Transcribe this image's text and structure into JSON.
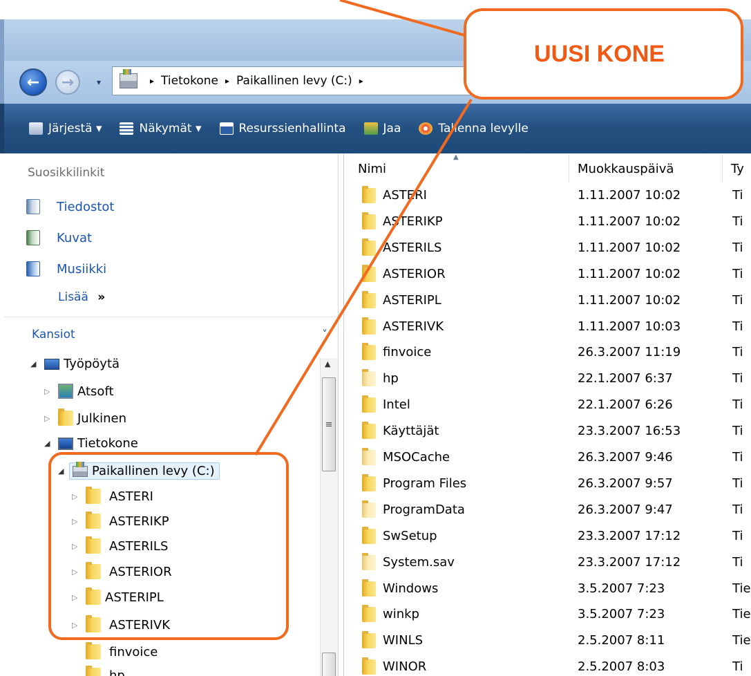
{
  "address": {
    "crumbs": [
      "Tietokone",
      "Paikallinen levy (C:)"
    ],
    "sep": "▸",
    "dropdown": "▾"
  },
  "nav": {
    "back_glyph": "←",
    "forward_glyph": "→"
  },
  "toolbar": {
    "items": [
      {
        "label": "Järjestä ▾",
        "icon": "organize-icon"
      },
      {
        "label": "Näkymät  ▾",
        "icon": "views-icon"
      },
      {
        "label": "Resurssienhallinta",
        "icon": "explorer-icon"
      },
      {
        "label": "Jaa",
        "icon": "share-icon"
      },
      {
        "label": "Tallenna levylle",
        "icon": "burn-icon"
      }
    ]
  },
  "favorites": {
    "title": "Suosikkilinkit",
    "links": [
      "Tiedostot",
      "Kuvat",
      "Musiikki"
    ],
    "more": "Lisää",
    "more_glyph": "»"
  },
  "folders": {
    "header": "Kansiot",
    "collapse_glyph": "˅",
    "tree": [
      {
        "label": "Työpöytä",
        "icon": "desktop-icon",
        "arrow": "◢"
      },
      {
        "label": "Atsoft",
        "icon": "atsoft-icon",
        "arrow": "▷"
      },
      {
        "label": "Julkinen",
        "icon": "folder-icon",
        "arrow": "▷"
      },
      {
        "label": "Tietokone",
        "icon": "computer-icon",
        "arrow": "◢"
      },
      {
        "label": "Paikallinen levy (C:)",
        "icon": "drive-icon",
        "arrow": "◢"
      },
      {
        "label": "ASTERI",
        "icon": "folder-icon",
        "arrow": "▷"
      },
      {
        "label": "ASTERIKP",
        "icon": "folder-icon",
        "arrow": "▷"
      },
      {
        "label": "ASTERILS",
        "icon": "folder-icon",
        "arrow": "▷"
      },
      {
        "label": "ASTERIOR",
        "icon": "folder-icon",
        "arrow": "▷"
      },
      {
        "label": "ASTERIPL",
        "icon": "folder-icon",
        "arrow": "▷"
      },
      {
        "label": "ASTERIVK",
        "icon": "folder-icon",
        "arrow": "▷"
      },
      {
        "label": "finvoice",
        "icon": "folder-icon",
        "arrow": ""
      },
      {
        "label": "hp",
        "icon": "folder-icon",
        "arrow": ""
      }
    ],
    "scroll_up": "▲",
    "scroll_grip": "≡"
  },
  "file_list": {
    "columns": [
      "Nimi",
      "Muokkauspäivä",
      "Ty"
    ],
    "sort_glyph": "▲",
    "rows": [
      {
        "name": "ASTERI",
        "date": "1.11.2007 10:02",
        "type": "Ti"
      },
      {
        "name": "ASTERIKP",
        "date": "1.11.2007 10:02",
        "type": "Ti"
      },
      {
        "name": "ASTERILS",
        "date": "1.11.2007 10:02",
        "type": "Ti"
      },
      {
        "name": "ASTERIOR",
        "date": "1.11.2007 10:02",
        "type": "Ti"
      },
      {
        "name": "ASTERIPL",
        "date": "1.11.2007 10:02",
        "type": "Ti"
      },
      {
        "name": "ASTERIVK",
        "date": "1.11.2007 10:03",
        "type": "Ti"
      },
      {
        "name": "finvoice",
        "date": "26.3.2007 11:19",
        "type": "Ti"
      },
      {
        "name": "hp",
        "date": "22.1.2007 6:37",
        "type": "Ti"
      },
      {
        "name": "Intel",
        "date": "22.1.2007 6:26",
        "type": "Ti"
      },
      {
        "name": "Käyttäjät",
        "date": "23.3.2007 16:53",
        "type": "Ti"
      },
      {
        "name": "MSOCache",
        "date": "26.3.2007 9:46",
        "type": "Ti"
      },
      {
        "name": "Program Files",
        "date": "26.3.2007 9:57",
        "type": "Ti"
      },
      {
        "name": "ProgramData",
        "date": "26.3.2007 9:47",
        "type": "Ti"
      },
      {
        "name": "SwSetup",
        "date": "23.3.2007 17:12",
        "type": "Ti"
      },
      {
        "name": "System.sav",
        "date": "23.3.2007 17:12",
        "type": "Ti"
      },
      {
        "name": "Windows",
        "date": "3.5.2007 7:23",
        "type": "Tie"
      },
      {
        "name": "winkp",
        "date": "3.5.2007 7:23",
        "type": "Tie"
      },
      {
        "name": "WINLS",
        "date": "2.5.2007 8:11",
        "type": "Tie"
      },
      {
        "name": "WINOR",
        "date": "2.5.2007 8:03",
        "type": "Ti"
      }
    ],
    "light_folders": [
      "hp",
      "MSOCache",
      "ProgramData",
      "System.sav"
    ]
  },
  "annotation": {
    "callout": "UUSI KONE",
    "color": "#f06a1f"
  }
}
